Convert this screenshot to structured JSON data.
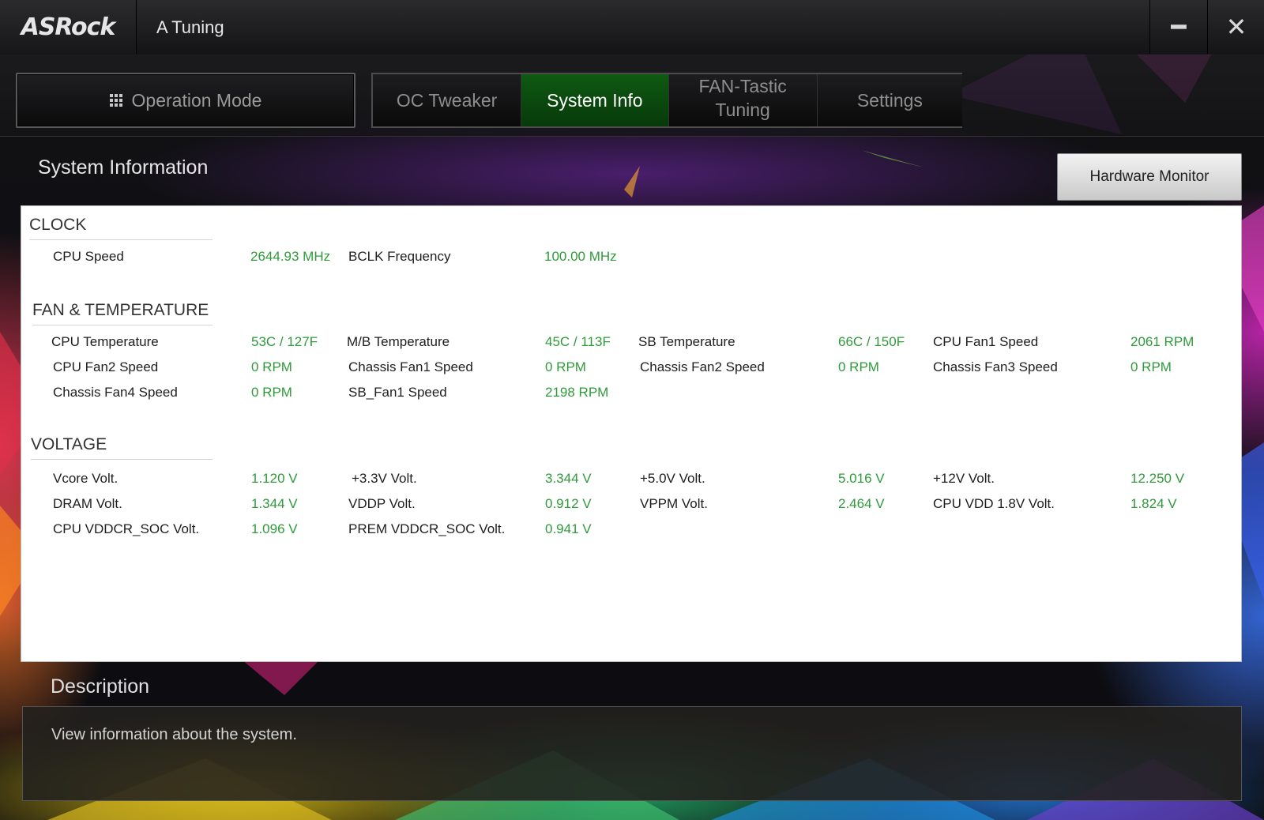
{
  "app": {
    "logo": "ASRock",
    "title": "A Tuning"
  },
  "window": {
    "minimize_glyph": "━",
    "close_glyph": "✕"
  },
  "nav": {
    "operation_mode": "Operation Mode",
    "tabs": [
      {
        "label": "OC Tweaker",
        "active": false
      },
      {
        "label": "System Info",
        "active": true
      },
      {
        "label": "FAN-Tastic Tuning",
        "active": false
      },
      {
        "label": "Settings",
        "active": false
      }
    ]
  },
  "section_title": "System Information",
  "hardware_monitor_button": "Hardware Monitor",
  "clock": {
    "title": "CLOCK",
    "cpu_speed_label": "CPU Speed",
    "cpu_speed_value": "2644.93 MHz",
    "bclk_label": "BCLK Frequency",
    "bclk_value": "100.00 MHz"
  },
  "fan_temp": {
    "title": "FAN & TEMPERATURE",
    "cpu_temp_label": "CPU Temperature",
    "cpu_temp_value": "53C / 127F",
    "mb_temp_label": "M/B Temperature",
    "mb_temp_value": "45C / 113F",
    "sb_temp_label": "SB Temperature",
    "sb_temp_value": "66C / 150F",
    "cpu_fan1_label": "CPU Fan1 Speed",
    "cpu_fan1_value": "2061 RPM",
    "cpu_fan2_label": "CPU Fan2 Speed",
    "cpu_fan2_value": "0 RPM",
    "chassis_fan1_label": "Chassis Fan1 Speed",
    "chassis_fan1_value": "0 RPM",
    "chassis_fan2_label": "Chassis Fan2 Speed",
    "chassis_fan2_value": "0 RPM",
    "chassis_fan3_label": "Chassis Fan3 Speed",
    "chassis_fan3_value": "0 RPM",
    "chassis_fan4_label": "Chassis Fan4 Speed",
    "chassis_fan4_value": "0 RPM",
    "sb_fan1_label": "SB_Fan1 Speed",
    "sb_fan1_value": "2198 RPM"
  },
  "voltage": {
    "title": "VOLTAGE",
    "vcore_label": "Vcore Volt.",
    "vcore_value": "1.120 V",
    "v33_label": "+3.3V Volt.",
    "v33_value": "3.344 V",
    "v50_label": "+5.0V Volt.",
    "v50_value": "5.016 V",
    "v12_label": "+12V Volt.",
    "v12_value": "12.250 V",
    "dram_label": "DRAM Volt.",
    "dram_value": "1.344 V",
    "vddp_label": "VDDP Volt.",
    "vddp_value": "0.912 V",
    "vppm_label": "VPPM Volt.",
    "vppm_value": "2.464 V",
    "cpu_vdd18_label": "CPU VDD 1.8V Volt.",
    "cpu_vdd18_value": "1.824 V",
    "cpu_vddcr_soc_label": "CPU VDDCR_SOC Volt.",
    "cpu_vddcr_soc_value": "1.096 V",
    "prem_vddcr_soc_label": "PREM VDDCR_SOC Volt.",
    "prem_vddcr_soc_value": "0.941 V"
  },
  "description": {
    "title": "Description",
    "text": "View information about the system."
  },
  "colors": {
    "accent_green": "#2f9a3a",
    "active_tab": "#0f5a12"
  }
}
